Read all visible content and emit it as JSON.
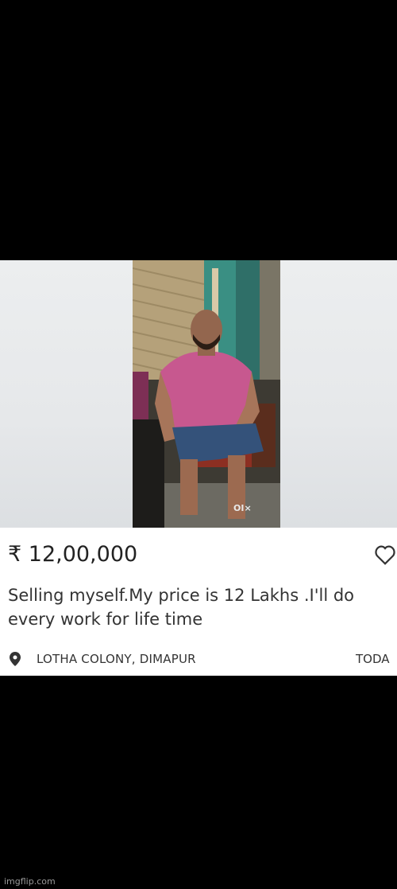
{
  "listing": {
    "price": "₹ 12,00,000",
    "title": "Selling myself.My price is 12 Lakhs .I'll do every work for life time",
    "location": "LOTHA COLONY, DIMAPUR",
    "date": "TODA",
    "watermark": "OI×"
  },
  "footer": {
    "credit": "imgflip.com"
  },
  "icons": {
    "favorite": "heart-icon",
    "location": "location-pin-icon"
  },
  "colors": {
    "shirt": "#c7588f",
    "background": "#000000",
    "card": "#ffffff"
  }
}
